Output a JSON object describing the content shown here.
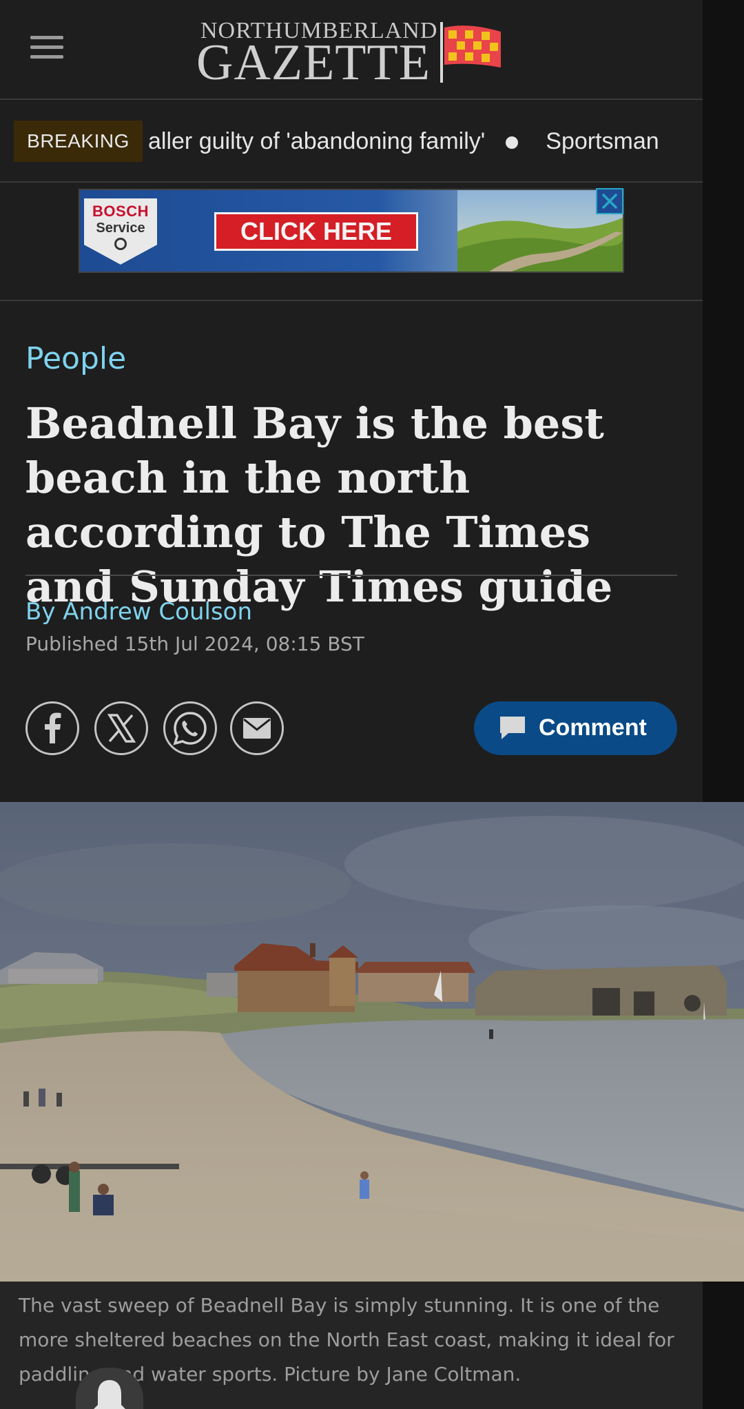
{
  "header": {
    "logo_top": "NORTHUMBERLAND",
    "logo_main": "GAZETTE",
    "menu_icon": "hamburger-menu-icon"
  },
  "breaking": {
    "badge": "BREAKING",
    "ticker": [
      "aller guilty of 'abandoning family'",
      "Sportsman"
    ]
  },
  "ad": {
    "brand_top": "BOSCH",
    "brand_bottom": "Service",
    "cta": "CLICK HERE",
    "close_icon": "close-icon"
  },
  "article": {
    "section": "People",
    "headline": "Beadnell Bay is the best beach in the north according to The Times and Sunday Times guide",
    "byline_prefix": "By ",
    "author": "Andrew Coulson",
    "published": "Published 15th Jul 2024, 08:15 BST",
    "share_icons": [
      "facebook-icon",
      "x-icon",
      "whatsapp-icon",
      "email-icon"
    ],
    "comment_label": "Comment",
    "caption": "The vast sweep of Beadnell Bay is simply stunning. It is one of the more sheltered beaches on the North East coast, making it ideal for paddling and water sports. Picture by Jane Coltman."
  },
  "colors": {
    "background": "#1e1e1e",
    "accent_link": "#7fd3ee",
    "comment_button": "#0a4a87",
    "breaking_badge": "#3a2a08",
    "ad_cta": "#d51e25"
  }
}
